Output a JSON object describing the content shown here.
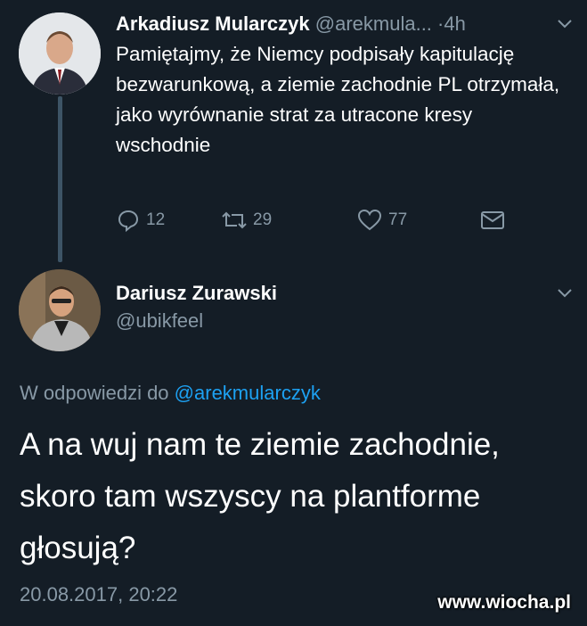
{
  "tweet1": {
    "name": "Arkadiusz Mularczyk",
    "handle": "@arekmula...",
    "separator": "·",
    "time": "4h",
    "text": "Pamiętajmy, że Niemcy podpisały kapitulację bezwarunkową, a ziemie zachodnie PL otrzymała, jako wyrównanie strat za utracone kresy wschodnie",
    "actions": {
      "replies": "12",
      "retweets": "29",
      "likes": "77"
    }
  },
  "tweet2": {
    "name": "Dariusz Zurawski",
    "handle": "@ubikfeel",
    "reply_prefix": "W odpowiedzi do",
    "reply_to": "@arekmularczyk",
    "text": "A na wuj nam te ziemie zachodnie, skoro tam wszyscy na plantforme głosują?",
    "date": "20.08.2017, 20:22"
  },
  "watermark": "www.wiocha.pl",
  "colors": {
    "background": "#141d26",
    "secondary_text": "#8899a6",
    "link": "#1da1f2",
    "thread_line": "#3d5466"
  },
  "icons": [
    "reply-icon",
    "retweet-icon",
    "like-icon",
    "direct-message-icon",
    "chevron-down-icon"
  ]
}
